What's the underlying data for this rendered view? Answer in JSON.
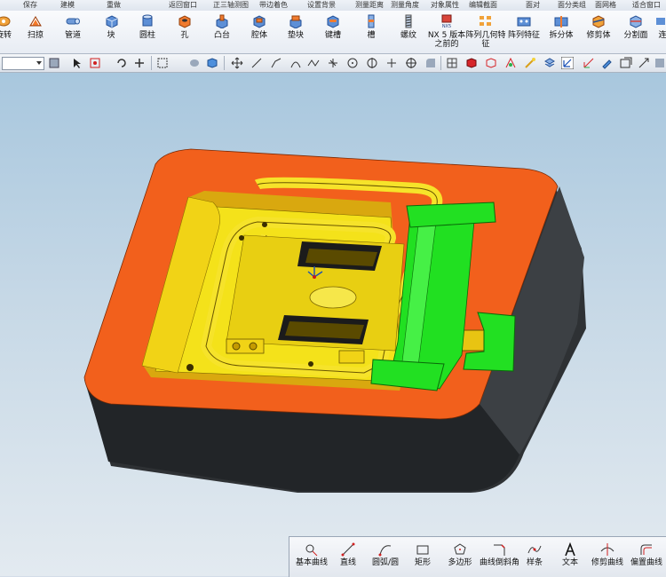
{
  "top_strip": [
    "保存",
    "建模",
    "重做",
    "返回窗口",
    "正三轴测图",
    "带边着色",
    "设置背景",
    "测量距离",
    "测量角度",
    "对象属性",
    "编辑截面",
    "面对",
    "面分类组",
    "面网格",
    "适合窗口"
  ],
  "ribbon": [
    {
      "label": "旋转",
      "icon": "revolve-icon"
    },
    {
      "label": "扫掠",
      "icon": "sweep-icon"
    },
    {
      "label": "管道",
      "icon": "tube-icon"
    },
    {
      "label": "块",
      "icon": "block-icon"
    },
    {
      "label": "圆柱",
      "icon": "cylinder-icon"
    },
    {
      "label": "孔",
      "icon": "hole-icon"
    },
    {
      "label": "凸台",
      "icon": "boss-icon"
    },
    {
      "label": "腔体",
      "icon": "pocket-icon"
    },
    {
      "label": "垫块",
      "icon": "pad-icon"
    },
    {
      "label": "键槽",
      "icon": "slot-icon"
    },
    {
      "label": "槽",
      "icon": "groove-icon"
    },
    {
      "label": "螺纹",
      "icon": "thread-icon"
    },
    {
      "label": "NX 5 版本之前的",
      "icon": "nx5-icon"
    },
    {
      "label": "阵列几何特征",
      "icon": "pattern-geometry-icon"
    },
    {
      "label": "阵列特征",
      "icon": "pattern-feature-icon"
    },
    {
      "label": "拆分体",
      "icon": "split-body-icon"
    },
    {
      "label": "修剪体",
      "icon": "trim-body-icon"
    },
    {
      "label": "分割面",
      "icon": "divide-face-icon"
    },
    {
      "label": "连",
      "icon": "connect-icon"
    }
  ],
  "bottom_toolbar": [
    {
      "label": "基本曲线",
      "icon": "basic-curve-icon"
    },
    {
      "label": "直线",
      "icon": "line-icon"
    },
    {
      "label": "圆弧/圆",
      "icon": "arc-icon"
    },
    {
      "label": "矩形",
      "icon": "rectangle-icon"
    },
    {
      "label": "多边形",
      "icon": "polygon-icon"
    },
    {
      "label": "曲线倒斜角",
      "icon": "curve-chamfer-icon"
    },
    {
      "label": "样条",
      "icon": "spline-icon"
    },
    {
      "label": "文本",
      "icon": "text-icon"
    },
    {
      "label": "修剪曲线",
      "icon": "trim-curve-icon"
    },
    {
      "label": "偏置曲线",
      "icon": "offset-curve-icon"
    }
  ],
  "colors": {
    "mold_top": "#f2601c",
    "mold_side": "#2f3235",
    "cavity": "#f4e21a",
    "slider": "#21e021",
    "accent_blue": "#1a4fb5"
  }
}
